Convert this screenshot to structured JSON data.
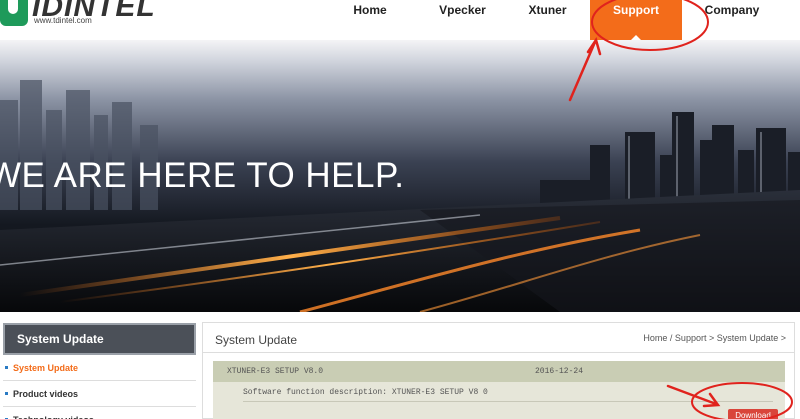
{
  "brand": {
    "logo_text": "IDINTEL",
    "url": "www.tdintel.com",
    "accent": "#f36c1a",
    "logo_color": "#1e9a5a"
  },
  "nav": {
    "home": "Home",
    "vpecker": "Vpecker",
    "xtuner": "Xtuner",
    "support": "Support",
    "company": "Company"
  },
  "banner": {
    "headline": "WE ARE HERE TO HELP."
  },
  "sidebar": {
    "title": "System Update",
    "items": [
      {
        "label": "System Update",
        "active": true
      },
      {
        "label": "Product videos",
        "active": false
      },
      {
        "label": "Technology videos",
        "active": false
      }
    ]
  },
  "main": {
    "title": "System Update",
    "breadcrumb": "Home  /  Support > System Update >",
    "entry": {
      "name": "XTUNER-E3 SETUP V8.0",
      "date": "2016-12-24",
      "description": "Software function description: XTUNER-E3 SETUP V8 0",
      "download_label": "Download"
    }
  }
}
